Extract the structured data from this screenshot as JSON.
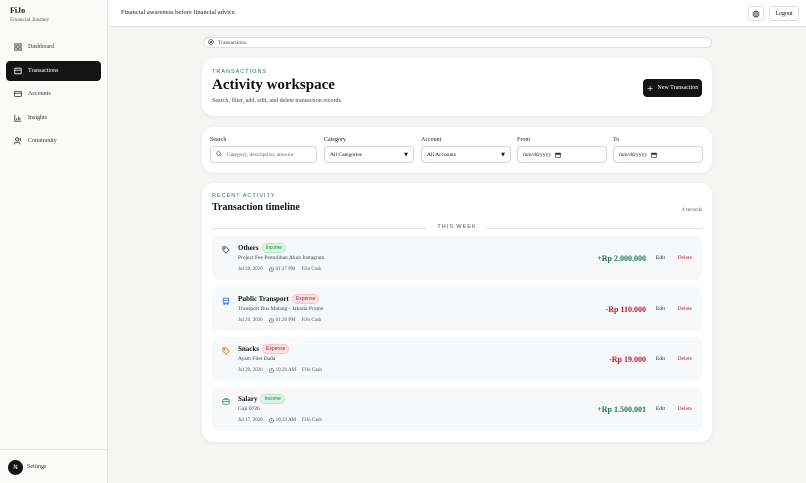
{
  "brand": {
    "name": "FiJo",
    "subtitle": "Financial Journey"
  },
  "nav": {
    "items": [
      {
        "label": "Dashboard",
        "icon": "dashboard-icon",
        "active": false
      },
      {
        "label": "Transactions",
        "icon": "wallet-icon",
        "active": true
      },
      {
        "label": "Accounts",
        "icon": "card-icon",
        "active": false
      },
      {
        "label": "Insights",
        "icon": "chart-icon",
        "active": false
      },
      {
        "label": "Community",
        "icon": "users-icon",
        "active": false
      }
    ]
  },
  "sidebar_footer": {
    "avatar_letter": "N",
    "settings_label": "Settings"
  },
  "topbar": {
    "tagline": "Financial awareness before financial advice.",
    "logout_label": "Logout"
  },
  "breadcrumb": {
    "label": "Transactions"
  },
  "hero": {
    "eyebrow": "TRANSACTIONS",
    "title": "Activity workspace",
    "subtitle": "Search, filter, add, edit, and delete transaction records.",
    "new_button": "New Transaction"
  },
  "filters": {
    "search_label": "Search",
    "search_placeholder": "Category, description, amount",
    "category_label": "Category",
    "category_value": "All Categories",
    "account_label": "Account",
    "account_value": "All Accounts",
    "from_label": "From",
    "from_placeholder": "mm/dd/yyyy",
    "to_label": "To",
    "to_placeholder": "mm/dd/yyyy"
  },
  "timeline": {
    "eyebrow": "RECENT ACTIVITY",
    "title": "Transaction timeline",
    "count": "4 records",
    "group_label": "THIS WEEK",
    "edit_label": "Edit",
    "delete_label": "Delete",
    "items": [
      {
        "name": "Others",
        "type": "Income",
        "description": "Project Fee Pemulihan Akun Instagram",
        "date": "Jul 20, 2026",
        "time": "01:27 PM",
        "account": "FiJo Cash",
        "amount": "+Rp 2.000.000",
        "icon_color": "#555555"
      },
      {
        "name": "Public Transport",
        "type": "Expense",
        "description": "Transport Bus Malang - Jakarta Promo",
        "date": "Jul 20, 2026",
        "time": "01:26 PM",
        "account": "FiJo Cash",
        "amount": "-Rp 110.000",
        "icon_color": "#3b6fd8"
      },
      {
        "name": "Snacks",
        "type": "Expense",
        "description": "Ayam Filet Dada",
        "date": "Jul 20, 2026",
        "time": "10:26 AM",
        "account": "FiJo Cash",
        "amount": "-Rp 19.000",
        "icon_color": "#e07a2f"
      },
      {
        "name": "Salary",
        "type": "Income",
        "description": "Gaji 0726",
        "date": "Jul 17, 2026",
        "time": "10:23 AM",
        "account": "FiJo Cash",
        "amount": "+Rp 1.500.001",
        "icon_color": "#2f9a5e"
      }
    ]
  },
  "colors": {
    "accent": "#1f7a55",
    "danger": "#b4232c",
    "dark": "#141414"
  }
}
